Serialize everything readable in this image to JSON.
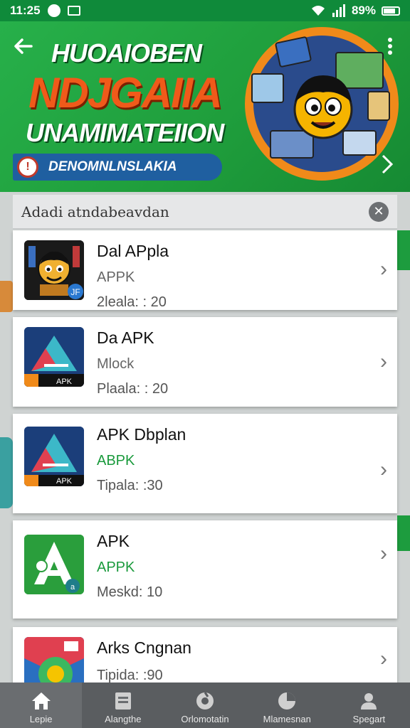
{
  "status_bar": {
    "time": "11:25",
    "battery": "89%"
  },
  "banner": {
    "line1": "HUOAIOBEN",
    "line2": "NDJGAIIA",
    "line3": "UNAMIMATEIION",
    "pill_text": "DENOMNLNSLAKIA"
  },
  "filter": {
    "text": "Adadi atndabeavdan"
  },
  "apps": [
    {
      "name": "Dal APpla",
      "sub": "APPK",
      "meta": "2leala: : 20"
    },
    {
      "name": "Da APK",
      "sub": "Mlock",
      "meta": "Plaala: : 20"
    },
    {
      "name": "APK Dbplan",
      "sub": "ABPK",
      "meta": "Tipala: :30"
    },
    {
      "name": "APK",
      "sub": "APPK",
      "meta": "Meskd:  10"
    },
    {
      "name": "Arks Cngnan",
      "sub": "",
      "meta": "Tipida: :90"
    }
  ],
  "nav": [
    {
      "label": "Lepie",
      "icon": "home-icon"
    },
    {
      "label": "Alangthe",
      "icon": "document-icon"
    },
    {
      "label": "Orlomotatin",
      "icon": "settings-icon"
    },
    {
      "label": "Mlamesnan",
      "icon": "chart-icon"
    },
    {
      "label": "Spegart",
      "icon": "person-icon"
    }
  ],
  "colors": {
    "primary_green": "#1f9e3c",
    "accent_orange": "#f05a1a",
    "pill_blue": "#1f5fa0",
    "nav_bg": "#5a5d60"
  }
}
